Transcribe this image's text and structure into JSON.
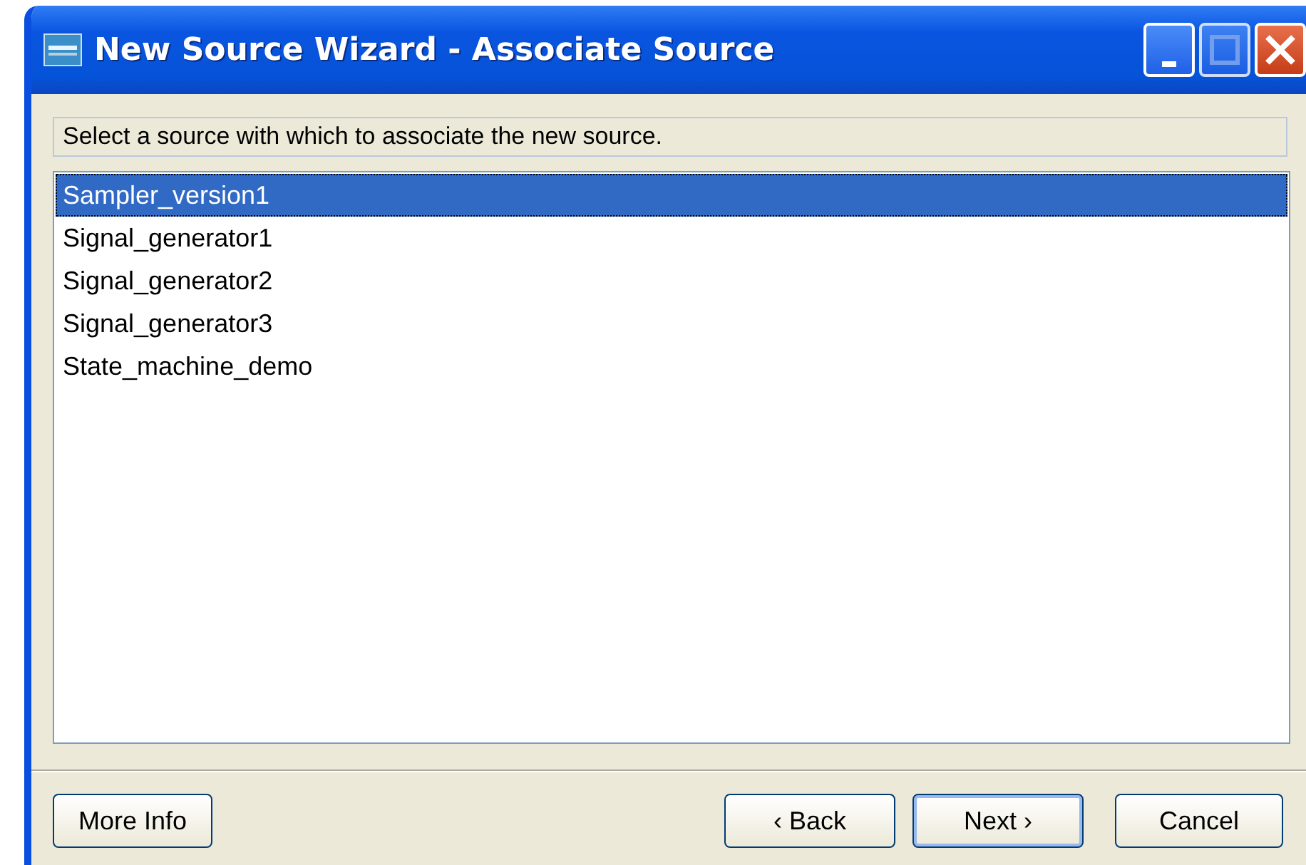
{
  "window": {
    "title": "New Source Wizard - Associate Source"
  },
  "instruction": "Select a source with which to associate the new source.",
  "sources": [
    {
      "label": "Sampler_version1",
      "selected": true
    },
    {
      "label": "Signal_generator1",
      "selected": false
    },
    {
      "label": "Signal_generator2",
      "selected": false
    },
    {
      "label": "Signal_generator3",
      "selected": false
    },
    {
      "label": "State_machine_demo",
      "selected": false
    }
  ],
  "buttons": [
    {
      "label": "More Info",
      "kind": "left",
      "default": false
    },
    {
      "label": "‹ Back",
      "kind": "nav",
      "default": false
    },
    {
      "label": "Next ›",
      "kind": "nav",
      "default": true
    },
    {
      "label": "Cancel",
      "kind": "cancel",
      "default": false
    }
  ]
}
